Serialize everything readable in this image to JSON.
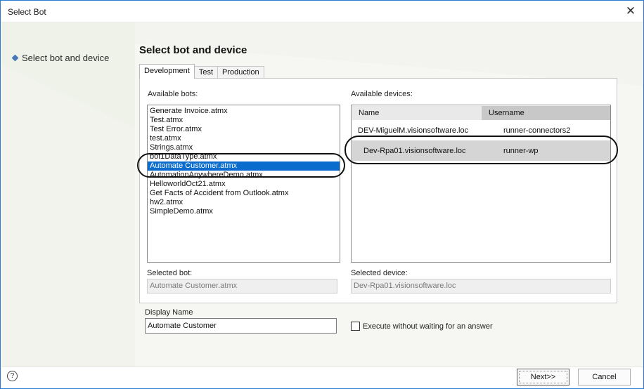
{
  "window": {
    "title": "Select Bot",
    "close_glyph": "✕"
  },
  "steps": [
    {
      "label": "Select bot and device"
    }
  ],
  "page_title": "Select bot and device",
  "tabs": [
    {
      "label": "Development",
      "active": true
    },
    {
      "label": "Test",
      "active": false
    },
    {
      "label": "Production",
      "active": false
    }
  ],
  "bots": {
    "label": "Available bots:",
    "items": [
      "Generate Invoice.atmx",
      "Test.atmx",
      "Test Error.atmx",
      "test.atmx",
      "Strings.atmx",
      "bot1DataType.atmx",
      "Automate Customer.atmx",
      "AutomationAnywhereDemo.atmx",
      "HelloworldOct21.atmx",
      "Get Facts of Accident from Outlook.atmx",
      "hw2.atmx",
      "SimpleDemo.atmx"
    ],
    "selected_index": 6
  },
  "devices": {
    "label": "Available devices:",
    "columns": {
      "name": "Name",
      "username": "Username"
    },
    "rows": [
      {
        "name": "DEV-MiguelM.visionsoftware.loc",
        "username": "runner-connectors2",
        "selected": false
      },
      {
        "name": "Dev-Rpa01.visionsoftware.loc",
        "username": "runner-wp",
        "selected": true
      }
    ]
  },
  "selected_bot": {
    "label": "Selected bot:",
    "value": "Automate Customer.atmx"
  },
  "selected_device": {
    "label": "Selected device:",
    "value": "Dev-Rpa01.visionsoftware.loc"
  },
  "display_name": {
    "label": "Display Name",
    "value": "Automate Customer"
  },
  "execute_option": {
    "label": "Execute without waiting for an answer",
    "checked": false
  },
  "footer": {
    "help_glyph": "?",
    "next_label": "Next>>",
    "cancel_label": "Cancel"
  },
  "colors": {
    "selection": "#0a6ccd",
    "accent_border": "#2b7bd6",
    "bullet": "#4a79b8"
  },
  "icons": {
    "close": "close-icon",
    "help": "help-icon",
    "step_bullet": "diamond-bullet-icon"
  }
}
